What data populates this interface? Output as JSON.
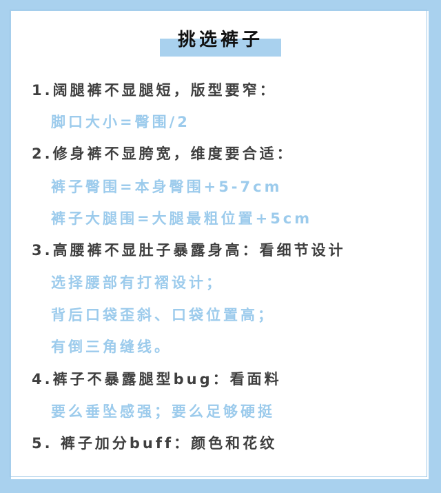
{
  "title": "挑选裤子",
  "colors": {
    "frame": "#a9d1ee",
    "heading_text": "#3f3f3f",
    "detail_text": "#9ccbec"
  },
  "lines": [
    "1.阔腿裤不显腿短，版型要窄：",
    "脚口大小=臀围/2",
    "2.修身裤不显胯宽，维度要合适：",
    "裤子臀围=本身臀围+5-7cm",
    "裤子大腿围=大腿最粗位置+5cm",
    "3.高腰裤不显肚子暴露身高：看细节设计",
    "选择腰部有打褶设计；",
    "背后口袋歪斜、口袋位置高；",
    "有倒三角缝线。",
    "4.裤子不暴露腿型bug：看面料",
    "要么垂坠感强；要么足够硬挺",
    "5. 裤子加分buff：颜色和花纹"
  ]
}
